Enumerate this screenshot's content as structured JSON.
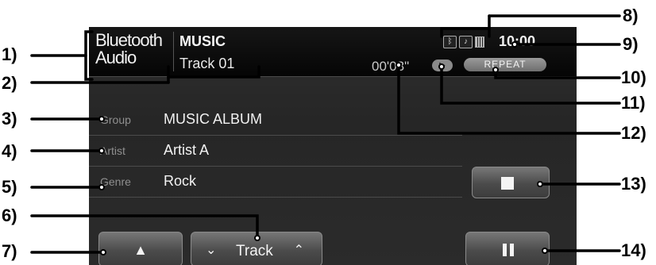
{
  "source": {
    "line1": "Bluetooth",
    "line2": "Audio"
  },
  "header": {
    "music_label": "MUSIC",
    "track_label": "Track 01",
    "elapsed_time": "00'03\"",
    "clock": "10:00",
    "repeat_label": "REPEAT",
    "status_icons": [
      "bluetooth-phone-icon",
      "bluetooth-audio-icon",
      "battery-icon"
    ],
    "play_indicator_icon": "play-icon"
  },
  "info_rows": [
    {
      "label": "Group",
      "value": "MUSIC ALBUM"
    },
    {
      "label": "Artist",
      "value": "Artist A"
    },
    {
      "label": "Genre",
      "value": "Rock"
    }
  ],
  "buttons": {
    "stop_icon": "stop-icon",
    "up_icon": "up-arrow-icon",
    "track_label": "Track",
    "pause_icon": "pause-icon"
  },
  "callouts": [
    "1)",
    "2)",
    "3)",
    "4)",
    "5)",
    "6)",
    "7)",
    "8)",
    "9)",
    "10)",
    "11)",
    "12)",
    "13)",
    "14)"
  ]
}
